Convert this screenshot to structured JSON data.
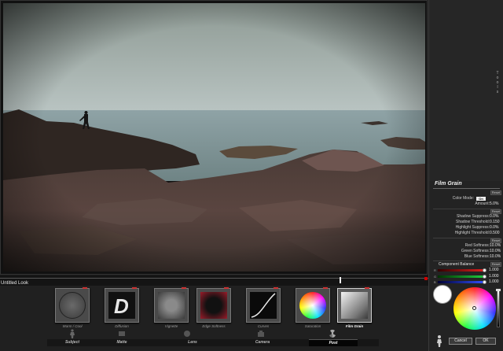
{
  "look": {
    "name": "Untitled Look"
  },
  "panel": {
    "side_letters": [
      "T",
      "o",
      "o",
      "l",
      "s"
    ],
    "title": "Film Grain",
    "reset_label": "Reset",
    "color_mode": {
      "label": "Color Mode:",
      "value": "On"
    },
    "amount": {
      "label": "Amount:",
      "value": "5.0%"
    },
    "shadow_suppress": {
      "label": "Shadow Suppress:",
      "value": "0.0%"
    },
    "shadow_threshold": {
      "label": "Shadow Threshold:",
      "value": "0.150"
    },
    "highlight_suppress": {
      "label": "Highlight Suppress:",
      "value": "0.0%"
    },
    "highlight_threshold": {
      "label": "Highlight Threshold:",
      "value": "0.500"
    },
    "red_softness": {
      "label": "Red Softness:",
      "value": "10.0%"
    },
    "green_softness": {
      "label": "Green Softness:",
      "value": "10.0%"
    },
    "blue_softness": {
      "label": "Blue Softness:",
      "value": "10.0%"
    },
    "component_balance": {
      "title": "Component Balance",
      "red": "1.000",
      "green": "1.000",
      "blue": "1.000"
    },
    "cancel_label": "Cancel",
    "ok_label": "OK"
  },
  "tools": [
    {
      "label": "Warm / Cool"
    },
    {
      "label": "Diffusion"
    },
    {
      "label": "Vignette"
    },
    {
      "label": "Edge Softness"
    },
    {
      "label": "Curves"
    },
    {
      "label": "Saturation"
    },
    {
      "label": "Film Grain",
      "selected": true
    }
  ],
  "tabs": [
    {
      "label": "Subject"
    },
    {
      "label": "Matte"
    },
    {
      "label": "Lens"
    },
    {
      "label": "Camera"
    },
    {
      "label": "Post",
      "selected": true
    }
  ],
  "colors": {
    "accent_red": "#cc2222",
    "panel_bg": "#232323",
    "selected_tab": "#050505"
  }
}
